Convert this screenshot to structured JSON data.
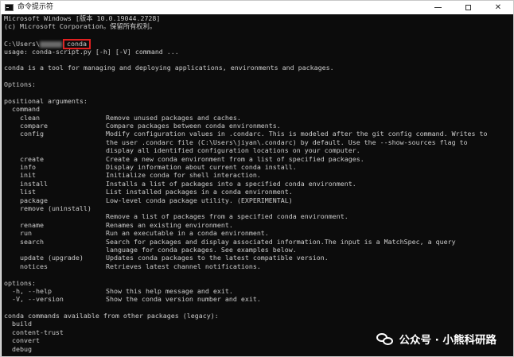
{
  "window": {
    "title": "命令提示符",
    "icon": "console-app-icon",
    "controls": {
      "minimize": "—",
      "maximize": "□",
      "close": "✕"
    }
  },
  "console": {
    "lines": [
      {
        "text": "Microsoft Windows [版本 10.0.19044.2728]"
      },
      {
        "text": "(c) Microsoft Corporation。保留所有权利。"
      },
      {
        "text": ""
      },
      {
        "prompt": "C:\\Users\\",
        "redacted": true,
        "command": "conda"
      },
      {
        "text": "usage: conda-script.py [-h] [-V] command ..."
      },
      {
        "text": ""
      },
      {
        "text": "conda is a tool for managing and deploying applications, environments and packages."
      },
      {
        "text": ""
      },
      {
        "text": "Options:"
      },
      {
        "text": ""
      },
      {
        "text": "positional arguments:"
      },
      {
        "text": "  command"
      },
      {
        "cmd": "    clean",
        "desc": "Remove unused packages and caches."
      },
      {
        "cmd": "    compare",
        "desc": "Compare packages between conda environments."
      },
      {
        "cmd": "    config",
        "desc": "Modify configuration values in .condarc. This is modeled after the git config command. Writes to"
      },
      {
        "cmd": "",
        "desc": "the user .condarc file (C:\\Users\\jiyan\\.condarc) by default. Use the --show-sources flag to"
      },
      {
        "cmd": "",
        "desc": "display all identified configuration locations on your computer."
      },
      {
        "cmd": "    create",
        "desc": "Create a new conda environment from a list of specified packages."
      },
      {
        "cmd": "    info",
        "desc": "Display information about current conda install."
      },
      {
        "cmd": "    init",
        "desc": "Initialize conda for shell interaction."
      },
      {
        "cmd": "    install",
        "desc": "Installs a list of packages into a specified conda environment."
      },
      {
        "cmd": "    list",
        "desc": "List installed packages in a conda environment."
      },
      {
        "cmd": "    package",
        "desc": "Low-level conda package utility. (EXPERIMENTAL)"
      },
      {
        "cmd": "    remove (uninstall)",
        "desc": ""
      },
      {
        "cmd": "",
        "desc": "Remove a list of packages from a specified conda environment."
      },
      {
        "cmd": "    rename",
        "desc": "Renames an existing environment."
      },
      {
        "cmd": "    run",
        "desc": "Run an executable in a conda environment."
      },
      {
        "cmd": "    search",
        "desc": "Search for packages and display associated information.The input is a MatchSpec, a query"
      },
      {
        "cmd": "",
        "desc": "language for conda packages. See examples below."
      },
      {
        "cmd": "    update (upgrade)",
        "desc": "Updates conda packages to the latest compatible version."
      },
      {
        "cmd": "    notices",
        "desc": "Retrieves latest channel notifications."
      },
      {
        "text": ""
      },
      {
        "text": "options:"
      },
      {
        "cmd": "  -h, --help",
        "desc": "Show this help message and exit."
      },
      {
        "cmd": "  -V, --version",
        "desc": "Show the conda version number and exit."
      },
      {
        "text": ""
      },
      {
        "text": "conda commands available from other packages (legacy):"
      },
      {
        "text": "  build"
      },
      {
        "text": "  content-trust"
      },
      {
        "text": "  convert"
      },
      {
        "text": "  debug"
      }
    ]
  },
  "watermark": {
    "text": "公众号 · 小熊科研路",
    "icon": "wechat-icon"
  }
}
